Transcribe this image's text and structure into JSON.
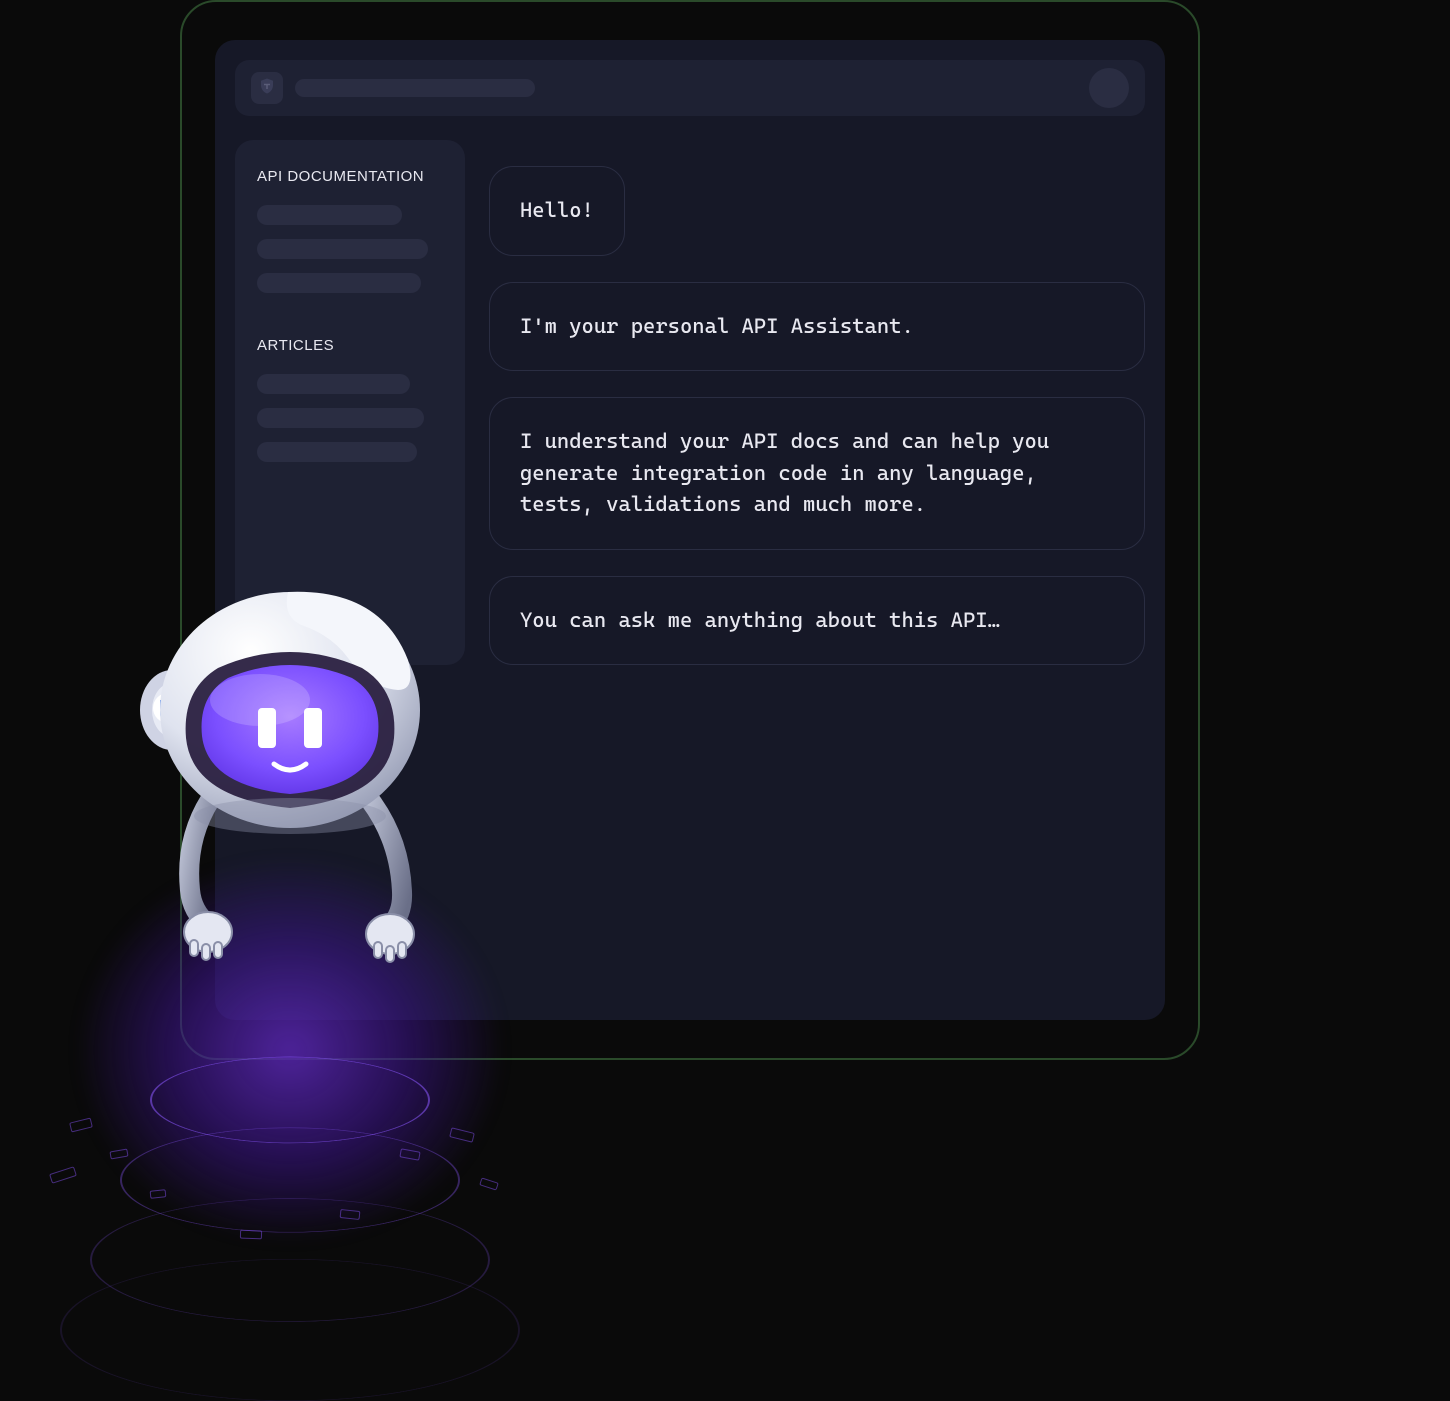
{
  "sidebar": {
    "section1_heading": "API DOCUMENTATION",
    "section2_heading": "ARTICLES"
  },
  "chat": {
    "messages": [
      {
        "text": "Hello!"
      },
      {
        "text": "I'm your personal API Assistant."
      },
      {
        "text": "I understand your API docs and can help you generate integration code in any language, tests, validations and much more."
      },
      {
        "text": "You can ask me anything about this API…"
      }
    ]
  },
  "colors": {
    "accent_purple": "#7b4fff",
    "bg_window": "#161827",
    "bg_panel": "#1e2133",
    "border_frame": "#2a4a2a"
  },
  "icons": {
    "logo": "shield-t-icon",
    "robot_badge": "shield-t-icon"
  }
}
